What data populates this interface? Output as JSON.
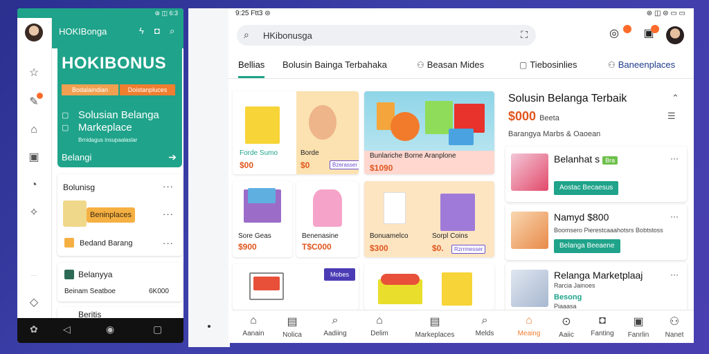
{
  "phone": {
    "status_icons": "⊛ ◫ 6:3",
    "app_name": "HOKIBonga",
    "brand": "HOKIBONUS",
    "chip_left": "Bodalaindian",
    "chip_right": "Doistanpluces",
    "hero_line1": "Solusian Belanga",
    "hero_line2": "Markeplace",
    "hero_small": "Brnidagus insupaalaslar",
    "hero_cta": "Belangi",
    "card1_title": "Bolunisg",
    "card1_pill": "Beninplaces",
    "card1_row2": "Bedand Barang",
    "card2_title": "Belanyya",
    "card2_row": "Beinam Seatboe",
    "card2_value": "6K000",
    "card3_title": "Beritis"
  },
  "app": {
    "status_left": "9:25 Ftt3 ⊜",
    "status_right": "⊛ ◫ ⊜ ▭ ▭",
    "search_text": "HKibonusga",
    "tabs": [
      {
        "label": "Bellias"
      },
      {
        "label": "Bolusin Bainga Terbahaka"
      },
      {
        "label": "Beasan Mides"
      },
      {
        "label": "Tiebosinlies"
      },
      {
        "label": "Baneenplaces"
      }
    ],
    "grid": [
      {
        "text": "Forde Sumo",
        "price": "$00"
      },
      {
        "text": "Borde",
        "price": "$0",
        "tag": "Bzerasser"
      },
      {
        "text": "Bunlariche Borne Aranplone",
        "price": "$1090"
      },
      {
        "text": "Sore Geas",
        "price": "$900"
      },
      {
        "text": "Benenasine",
        "price": "T$C000"
      },
      {
        "text": "Bonuamelco",
        "price": "$300"
      },
      {
        "text": "Sorpl Coins",
        "price": "$0.",
        "tag": "Rzrrmesser"
      },
      {
        "tag": "Mobes"
      }
    ],
    "panel_title": "Solusin Belanga Terbaik",
    "panel_price": "$000",
    "panel_price_suffix": "Beeta",
    "panel_sub": "Barangya Marbs & Oaoean",
    "right_cards": [
      {
        "title": "Belanhat s",
        "badge": "Bra",
        "button": "Aostac Becaesus"
      },
      {
        "title": "Namyd $800",
        "sub": "Boomsero Pierestcaaahotsrs Bobtstoss",
        "button": "Belanga Beeaene"
      },
      {
        "title": "Relanga Marketplaaj",
        "sub": "Rarcia Jainoes",
        "link": "Besong",
        "sub2": "Piaaasa"
      }
    ],
    "bottom_nav": [
      {
        "label": "Aanain",
        "icon": "home-icon"
      },
      {
        "label": "Nolica",
        "icon": "document-icon"
      },
      {
        "label": "Aadiing",
        "icon": "search-icon"
      },
      {
        "label": "Delim",
        "icon": "house-icon"
      },
      {
        "label": "Markeplaces",
        "icon": "list-icon"
      },
      {
        "label": "Melds",
        "icon": "search-icon"
      },
      {
        "label": "Meaing",
        "icon": "shop-icon"
      },
      {
        "label": "Aaiic",
        "icon": "circle-icon"
      },
      {
        "label": "Fanting",
        "icon": "bag-icon"
      },
      {
        "label": "Fanrlin",
        "icon": "square-icon"
      },
      {
        "label": "Nanet",
        "icon": "user-icon"
      }
    ]
  },
  "colors": {
    "teal": "#1fa38a",
    "orange": "#f07e30",
    "purple": "#6a4fd0",
    "price": "#e0561e"
  }
}
